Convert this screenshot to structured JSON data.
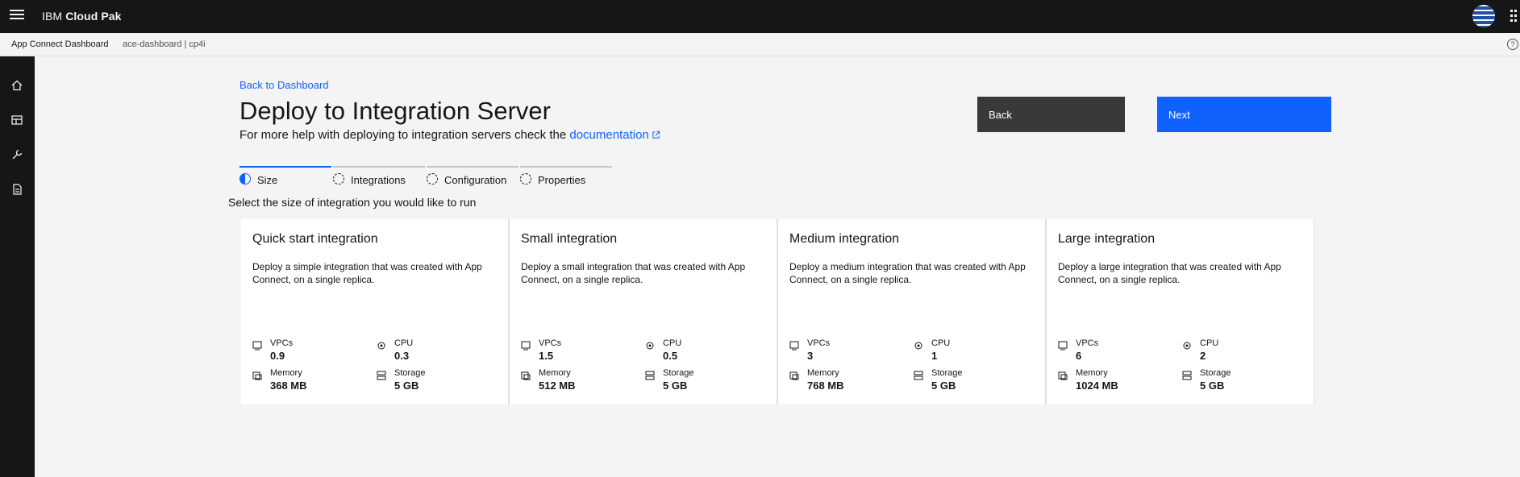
{
  "header": {
    "brand_prefix": "IBM",
    "brand_name": "Cloud Pak"
  },
  "subbar": {
    "app_name": "App Connect Dashboard",
    "namespace": "ace-dashboard  |  cp4i"
  },
  "sidenav": {
    "items": [
      "home-icon",
      "dashboard-icon",
      "tools-icon",
      "document-icon"
    ]
  },
  "page": {
    "back_link": "Back to Dashboard",
    "title": "Deploy to Integration Server",
    "help_prefix": "For more help with deploying to integration servers check the ",
    "help_link": "documentation",
    "back_button": "Back",
    "next_button": "Next",
    "select_text": "Select the size of integration you would like to run"
  },
  "steps": [
    {
      "label": "Size",
      "state": "current"
    },
    {
      "label": "Integrations",
      "state": "incomplete"
    },
    {
      "label": "Configuration",
      "state": "incomplete"
    },
    {
      "label": "Properties",
      "state": "incomplete"
    }
  ],
  "metric_labels": {
    "vpcs": "VPCs",
    "cpu": "CPU",
    "memory": "Memory",
    "storage": "Storage"
  },
  "cards": [
    {
      "title": "Quick start integration",
      "description": "Deploy a simple integration that was created with App Connect, on a single replica.",
      "vpcs": "0.9",
      "cpu": "0.3",
      "memory": "368 MB",
      "storage": "5 GB"
    },
    {
      "title": "Small integration",
      "description": "Deploy a small integration that was created with App Connect, on a single replica.",
      "vpcs": "1.5",
      "cpu": "0.5",
      "memory": "512 MB",
      "storage": "5 GB"
    },
    {
      "title": "Medium integration",
      "description": "Deploy a medium integration that was created with App Connect, on a single replica.",
      "vpcs": "3",
      "cpu": "1",
      "memory": "768 MB",
      "storage": "5 GB"
    },
    {
      "title": "Large integration",
      "description": "Deploy a large integration that was created with App Connect, on a single replica.",
      "vpcs": "6",
      "cpu": "2",
      "memory": "1024 MB",
      "storage": "5 GB"
    }
  ],
  "colors": {
    "accent": "#0f62fe",
    "header_bg": "#161616",
    "secondary_button": "#393939"
  }
}
